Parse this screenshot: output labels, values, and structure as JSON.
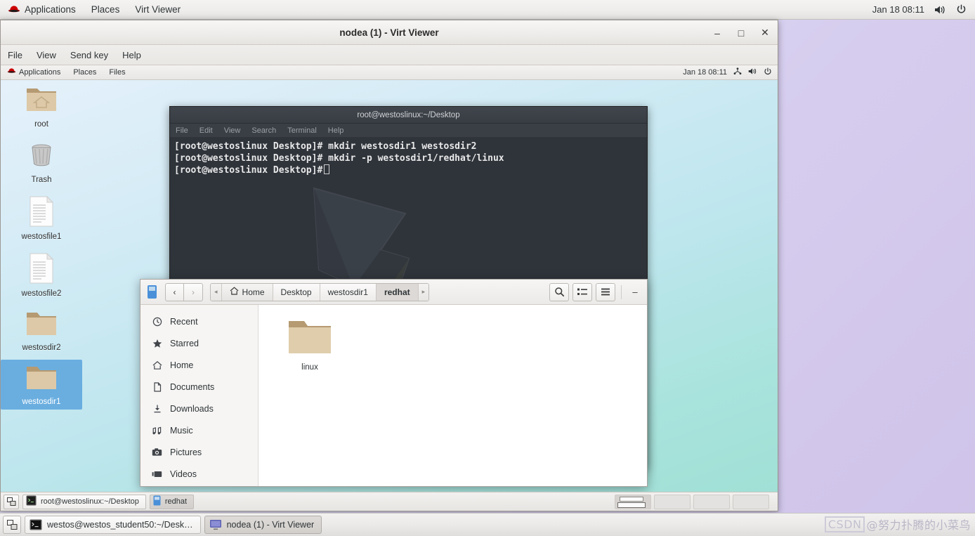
{
  "host": {
    "panel": {
      "menus": [
        {
          "label": "Applications",
          "icon": "redhat-logo-icon"
        },
        {
          "label": "Places",
          "icon": ""
        },
        {
          "label": "Virt Viewer",
          "icon": ""
        }
      ],
      "clock": "Jan 18  08:11",
      "volume_icon": "volume-icon",
      "power_icon": "power-icon"
    },
    "taskbar": {
      "show_desktop_icon": "show-desktop-icon",
      "tasks": [
        {
          "label": "westos@westos_student50:~/Desk…",
          "icon": "terminal-icon",
          "active": false
        },
        {
          "label": "nodea (1) - Virt Viewer",
          "icon": "display-icon",
          "active": true
        }
      ]
    },
    "watermark": {
      "badge": "CSDN",
      "text": "@努力扑腾的小菜鸟"
    }
  },
  "virt_viewer": {
    "title": "nodea (1) - Virt Viewer",
    "window_buttons": {
      "minimize": "–",
      "maximize": "□",
      "close": "✕"
    },
    "menus": [
      "File",
      "View",
      "Send key",
      "Help"
    ]
  },
  "guest": {
    "panel": {
      "menus": [
        {
          "label": "Applications",
          "icon": "redhat-logo-icon"
        },
        {
          "label": "Places",
          "icon": ""
        },
        {
          "label": "Files",
          "icon": ""
        }
      ],
      "clock": "Jan 18  08:11",
      "network_icon": "network-icon",
      "volume_icon": "volume-icon",
      "power_icon": "power-icon"
    },
    "desktop_icons": [
      {
        "label": "root",
        "type": "home-folder",
        "selected": false
      },
      {
        "label": "Trash",
        "type": "trash",
        "selected": false
      },
      {
        "label": "westosfile1",
        "type": "file",
        "selected": false
      },
      {
        "label": "westosfile2",
        "type": "file",
        "selected": false
      },
      {
        "label": "westosdir2",
        "type": "folder",
        "selected": false
      },
      {
        "label": "westosdir1",
        "type": "folder",
        "selected": true
      }
    ],
    "terminal": {
      "title": "root@westoslinux:~/Desktop",
      "menus": [
        "File",
        "Edit",
        "View",
        "Search",
        "Terminal",
        "Help"
      ],
      "lines": [
        {
          "prompt": "[root@westoslinux Desktop]#",
          "command": " mkdir westosdir1 westosdir2"
        },
        {
          "prompt": "[root@westoslinux Desktop]#",
          "command": " mkdir -p westosdir1/redhat/linux"
        },
        {
          "prompt": "[root@westoslinux Desktop]#",
          "command": ""
        }
      ]
    },
    "file_manager": {
      "app_icon": "files-app-icon",
      "nav": {
        "back": "‹",
        "forward": "›"
      },
      "breadcrumb_left_arrow": "◂",
      "breadcrumb_right_arrow": "▸",
      "breadcrumbs": [
        {
          "label": "Home",
          "icon": "home-icon",
          "current": false
        },
        {
          "label": "Desktop",
          "icon": "",
          "current": false
        },
        {
          "label": "westosdir1",
          "icon": "",
          "current": false
        },
        {
          "label": "redhat",
          "icon": "",
          "current": true
        }
      ],
      "toolbar": {
        "search": "search-icon",
        "view_list": "view-list-icon",
        "menu": "hamburger-menu-icon",
        "minimize": "–"
      },
      "sidebar": [
        {
          "label": "Recent",
          "icon": "clock-icon"
        },
        {
          "label": "Starred",
          "icon": "star-icon"
        },
        {
          "label": "Home",
          "icon": "home-icon"
        },
        {
          "label": "Documents",
          "icon": "document-icon"
        },
        {
          "label": "Downloads",
          "icon": "download-icon"
        },
        {
          "label": "Music",
          "icon": "music-icon"
        },
        {
          "label": "Pictures",
          "icon": "camera-icon"
        },
        {
          "label": "Videos",
          "icon": "video-icon"
        }
      ],
      "files": [
        {
          "label": "linux",
          "type": "folder"
        }
      ]
    },
    "taskbar": {
      "show_desktop_icon": "show-desktop-icon",
      "tasks": [
        {
          "label": "root@westoslinux:~/Desktop",
          "icon": "terminal-icon",
          "active": false
        },
        {
          "label": "redhat",
          "icon": "files-app-icon",
          "active": true
        }
      ],
      "workspaces": [
        {
          "active": true
        },
        {
          "active": false
        },
        {
          "active": false
        },
        {
          "active": false
        }
      ]
    }
  },
  "colors": {
    "host_desktop": "#d6cdee",
    "guest_desktop": "#bfe6ee",
    "terminal_bg": "#2f343b",
    "selection_blue": "#6aaee0",
    "redhat_red": "#cc0000"
  }
}
